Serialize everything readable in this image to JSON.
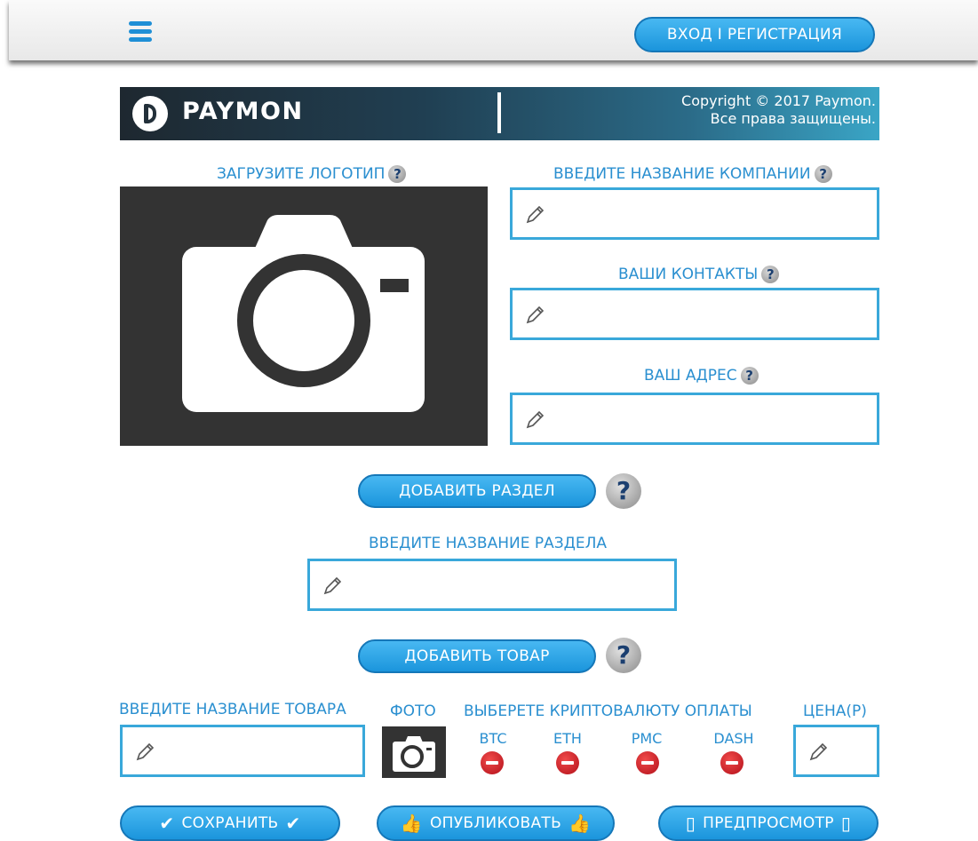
{
  "header": {
    "login_button": "ВХОД I РЕГИСТРАЦИЯ"
  },
  "banner": {
    "logo_text": "PAYMON",
    "copyright_line1": "Copyright © 2017 Paymon.",
    "copyright_line2": "Все права защищены."
  },
  "logo_upload": {
    "label": "ЗАГРУЗИТЕ ЛОГОТИП"
  },
  "company": {
    "name_label": "ВВЕДИТЕ НАЗВАНИЕ КОМПАНИИ",
    "contacts_label": "ВАШИ КОНТАКТЫ",
    "address_label": "ВАШ АДРЕС"
  },
  "section": {
    "add_button": "ДОБАВИТЬ РАЗДЕЛ",
    "name_label": "ВВЕДИТЕ НАЗВАНИЕ РАЗДЕЛА"
  },
  "product": {
    "add_button": "ДОБАВИТЬ ТОВАР",
    "name_label": "ВВЕДИТЕ НАЗВАНИЕ ТОВАРА",
    "photo_label": "ФОТО",
    "crypto_label": "ВЫБЕРЕТЕ КРИПТОВАЛЮТУ ОПЛАТЫ",
    "price_label": "ЦЕНА(Р)",
    "currencies": [
      "BTC",
      "ETH",
      "PMC",
      "DASH"
    ]
  },
  "actions": {
    "save": "СОХРАНИТЬ",
    "publish": "ОПУБЛИКОВАТЬ",
    "preview": "ПРЕДПРОСМОТР"
  },
  "icons": {
    "help": "?",
    "check": "✔",
    "thumbs_up": "👍",
    "phone": "▯"
  },
  "colors": {
    "accent": "#2a8fd0",
    "button": "#1b95dc",
    "dark_placeholder": "#333333",
    "remove": "#d01a24"
  }
}
